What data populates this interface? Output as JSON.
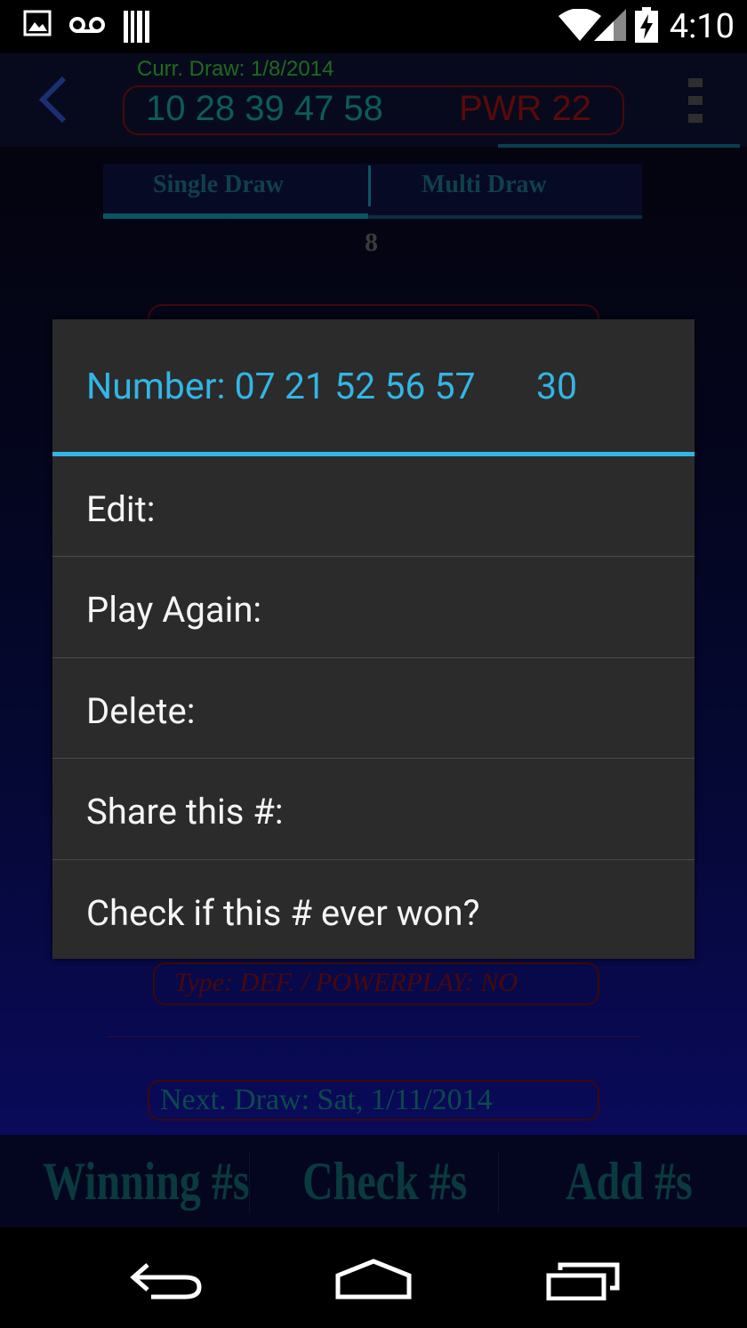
{
  "status_bar": {
    "time": "4:10",
    "icons": [
      "image-icon",
      "voicemail-icon",
      "barcode-icon",
      "wifi-icon",
      "signal-icon",
      "battery-charging-icon"
    ]
  },
  "header": {
    "current_draw_label": "Curr. Draw: 1/8/2014",
    "draw_numbers": "10 28 39 47 58",
    "powerball": "PWR  22"
  },
  "tabs": [
    {
      "label": "Single Draw",
      "selected": true
    },
    {
      "label": "Multi Draw",
      "selected": false
    }
  ],
  "count": "8",
  "background": {
    "next_draw_top": "Next. Draw: Sat, 1/11/2014",
    "type_line": "Type: DEF.  / POWERPLAY:  NO",
    "next_draw": "Next. Draw: Sat, 1/11/2014"
  },
  "bottom_nav": {
    "winning": "Winning #s",
    "check": "Check #s",
    "add": "Add #s"
  },
  "dialog": {
    "title_prefix": "Number: 07 21 52 56 57",
    "title_powerball": "30",
    "items": [
      "Edit:",
      "Play Again:",
      "Delete:",
      "Share this #:",
      "Check if this # ever won?"
    ]
  },
  "colors": {
    "accent": "#33b5e5",
    "dialog_bg": "#2b2b2b",
    "draw_numbers": "#0b5c5a",
    "powerball": "#5a0909"
  }
}
